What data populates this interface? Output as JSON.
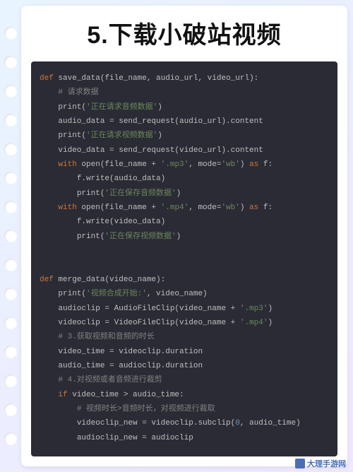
{
  "title": "5.下载小破站视频",
  "watermark": "大理手游网",
  "code": {
    "fn1": {
      "def": "def",
      "name": "save_data",
      "params": "(file_name, audio_url, video_url):",
      "c1": "# 请求数据",
      "l1a": "print(",
      "l1s": "'正在请求音频数据'",
      "l1b": ")",
      "l2": "audio_data = send_request(audio_url).content",
      "l3a": "print(",
      "l3s": "'正在请求视频数据'",
      "l3b": ")",
      "l4": "video_data = send_request(video_url).content",
      "l5a": "with",
      "l5b": " open(file_name + ",
      "l5s1": "'.mp3'",
      "l5c": ", mode=",
      "l5s2": "'wb'",
      "l5d": ") ",
      "l5e": "as",
      "l5f": " f:",
      "l6": "f.write(audio_data)",
      "l7a": "print(",
      "l7s": "'正在保存音频数据'",
      "l7b": ")",
      "l8a": "with",
      "l8b": " open(file_name + ",
      "l8s1": "'.mp4'",
      "l8c": ", mode=",
      "l8s2": "'wb'",
      "l8d": ") ",
      "l8e": "as",
      "l8f": " f:",
      "l9": "f.write(video_data)",
      "l10a": "print(",
      "l10s": "'正在保存视频数据'",
      "l10b": ")"
    },
    "fn2": {
      "def": "def",
      "name": "merge_data",
      "params": "(video_name):",
      "l1a": "print(",
      "l1s": "'视频合成开始:'",
      "l1b": ", video_name)",
      "l2a": "audioclip = AudioFileClip(video_name + ",
      "l2s": "'.mp3'",
      "l2b": ")",
      "l3a": "videoclip = VideoFileClip(video_name + ",
      "l3s": "'.mp4'",
      "l3b": ")",
      "c1": "# 3.获取视频和音频的时长",
      "l4": "video_time = videoclip.duration",
      "l5": "audio_time = audioclip.duration",
      "c2": "# 4.对视频或者音频进行裁剪",
      "l6a": "if",
      "l6b": " video_time > audio_time:",
      "c3": "# 视频时长>音频时长，对视频进行裁取",
      "l7a": "videoclip_new = videoclip.subclip(",
      "l7n": "0",
      "l7b": ", audio_time)",
      "l8": "audioclip_new = audioclip"
    }
  }
}
